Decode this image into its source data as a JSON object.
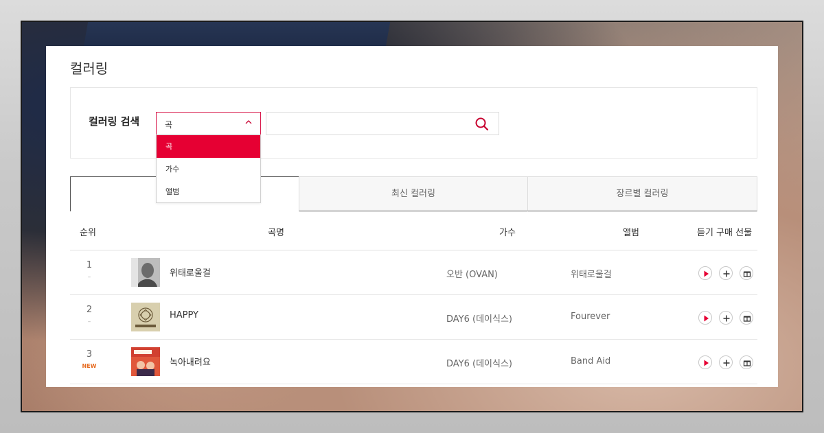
{
  "page": {
    "title": "컬러링"
  },
  "search": {
    "label": "컬러링 검색",
    "selected": "곡",
    "options": [
      "곡",
      "가수",
      "앨범"
    ],
    "placeholder": ""
  },
  "tabs": [
    {
      "label": ""
    },
    {
      "label": "최신 컬러링"
    },
    {
      "label": "장르별 컬러링"
    }
  ],
  "table": {
    "headers": {
      "rank": "순위",
      "song": "곡명",
      "artist": "가수",
      "album": "앨범",
      "actions": "듣기 구매 선물"
    },
    "rows": [
      {
        "rank": "1",
        "change": "–",
        "title": "위태로울걸",
        "artist": "오반 (OVAN)",
        "album": "위태로울걸"
      },
      {
        "rank": "2",
        "change": "–",
        "title": "HAPPY",
        "artist": "DAY6 (데이식스)",
        "album": "Fourever"
      },
      {
        "rank": "3",
        "change": "NEW",
        "title": "녹아내려요",
        "artist": "DAY6 (데이식스)",
        "album": "Band Aid"
      }
    ]
  },
  "colors": {
    "accent": "#e60033"
  }
}
